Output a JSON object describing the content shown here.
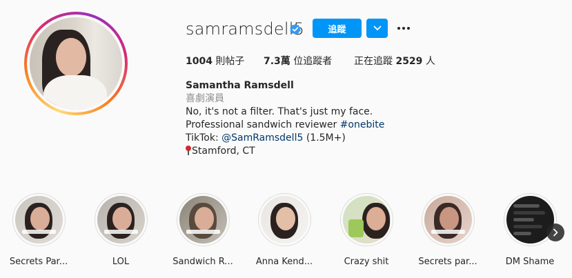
{
  "profile": {
    "username": "samramsdell5",
    "verified": true,
    "follow_label": "追蹤",
    "stats": {
      "posts_value": "1004",
      "posts_label": "則帖子",
      "followers_value": "7.3萬",
      "followers_label": "位追蹤者",
      "following_prefix": "正在追蹤",
      "following_value": "2529",
      "following_suffix": "人"
    },
    "bio": {
      "name": "Samantha Ramsdell",
      "category": "喜劇演員",
      "line1": "No, it's not a filter. That's just my face.",
      "line2_text": "Professional sandwich reviewer ",
      "line2_link": "#onebite",
      "line3_prefix": "TikTok: ",
      "line3_link": "@SamRamsdell5",
      "line3_suffix": " (1.5M+)",
      "line4": "Stamford, CT"
    }
  },
  "highlights": [
    {
      "label": "Secrets Par..."
    },
    {
      "label": "LOL"
    },
    {
      "label": "Sandwich R..."
    },
    {
      "label": "Anna Kend..."
    },
    {
      "label": "Crazy shit"
    },
    {
      "label": "Secrets par..."
    },
    {
      "label": "DM Shame"
    }
  ],
  "colors": {
    "accent": "#0095f6",
    "link": "#00376b",
    "verified": "#3897f0"
  },
  "icons": {
    "verified": "verified-badge-icon",
    "dropdown": "chevron-down-icon",
    "more": "more-options-icon",
    "location": "location-pin-icon",
    "next": "chevron-right-icon"
  }
}
